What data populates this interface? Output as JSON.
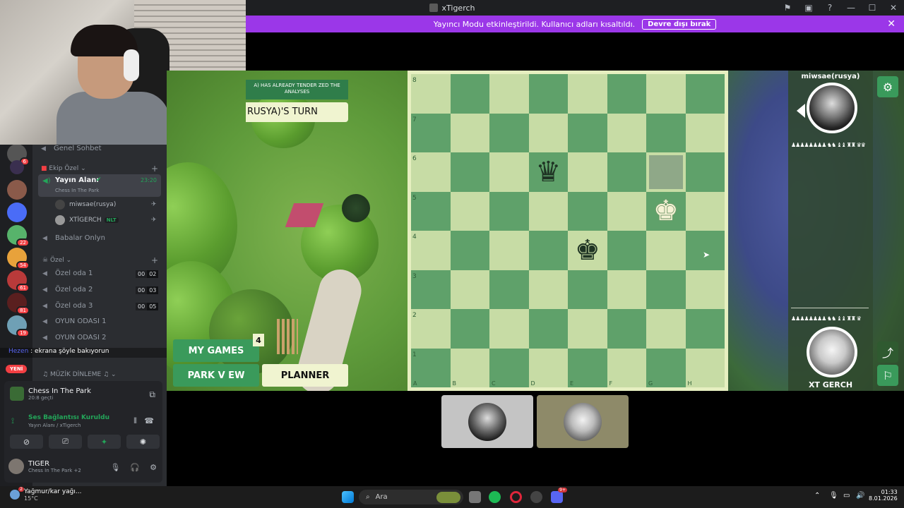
{
  "window": {
    "title": "xTigerch"
  },
  "banner": {
    "text": "Yayıncı Modu etkinleştirildi. Kullanıcı adları kısaltıldı.",
    "button": "Devre dışı bırak"
  },
  "overlay": {
    "message": "ekrana şöyle bakıyorun",
    "user": "Hezen"
  },
  "servers": {
    "badges": [
      "6",
      "22",
      "54",
      "61",
      "81",
      "19"
    ],
    "new_label": "YENİ"
  },
  "channels": {
    "top_channel": "Genel Sohbet",
    "category_ekip": "Ekip Özel",
    "active": {
      "name": "Yayın Alanı",
      "time": "23:20",
      "activity": "Chess In The Park"
    },
    "users": [
      {
        "name": "miwsae(rusya)"
      },
      {
        "name": "XTİGERCH",
        "tag": "NLT"
      }
    ],
    "babalar": "Babalar Onlyn",
    "category_ozel": "Özel",
    "rooms": [
      {
        "name": "Özel oda 1",
        "a": "00",
        "b": "02"
      },
      {
        "name": "Özel oda 2",
        "a": "00",
        "b": "03"
      },
      {
        "name": "Özel oda 3",
        "a": "00",
        "b": "05"
      }
    ],
    "game_rooms": [
      "OYUN ODASI 1",
      "OYUN ODASI 2"
    ],
    "category_muzik": "MÜZİK DİNLEME"
  },
  "voice_panel": {
    "activity_title": "Chess In The Park",
    "activity_time": "20:8 geçti",
    "connection": "Ses Bağlantısı Kuruldu",
    "connection_sub": "Yayın Alanı / xTigerch",
    "user_name": "TIGER",
    "user_status": "Chess In The Park +2"
  },
  "game": {
    "notice": "A) HAS ALREADY TENDER ZED THE ANALYSES",
    "turn": "RUSYA)'S TURN",
    "my_games": "MY GAMES",
    "my_games_count": "4",
    "park_view": "PARK V EW",
    "planner": "PLANNER"
  },
  "board": {
    "ranks": [
      "8",
      "7",
      "6",
      "5",
      "4",
      "3",
      "2",
      "1"
    ],
    "files": [
      "A",
      "B",
      "C",
      "D",
      "E",
      "F",
      "G",
      "H"
    ],
    "pieces": [
      {
        "square": "d6",
        "symbol": "♛",
        "color": "black"
      },
      {
        "square": "g5",
        "symbol": "♚",
        "color": "white"
      },
      {
        "square": "e4",
        "symbol": "♚",
        "color": "black"
      }
    ],
    "highlight": "g6",
    "colors": {
      "light": "#c7dca5",
      "dark": "#5fa16a",
      "frame": "#e6efc0"
    }
  },
  "players": {
    "top": {
      "name": "miwsae(rusya)",
      "captured": "♟♟♟♟♟♟♟♟ ♞♞ ♝♝ ♜♜ ♛♛"
    },
    "bottom": {
      "name": "XT GERCH",
      "captured": "♟♟♟♟♟♟♟♟ ♞♞ ♝♝ ♜♜ ♛"
    }
  },
  "taskbar": {
    "weather_text": "Yağmur/kar yağı...",
    "weather_temp": "15°C",
    "weather_badge": "2",
    "search_placeholder": "Ara",
    "time": "01:33",
    "date": "8.01.2026",
    "discord_badge": "9+"
  }
}
